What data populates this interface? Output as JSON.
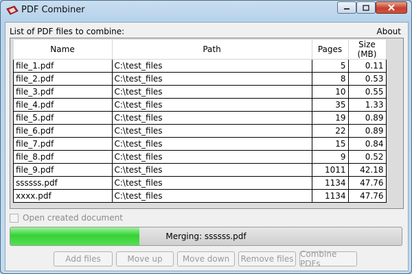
{
  "window": {
    "title": "PDF Combiner",
    "icon": "pdf-icon"
  },
  "header": {
    "list_label": "List of PDF files to combine:",
    "about": "About"
  },
  "table": {
    "columns": [
      "Name",
      "Path",
      "Pages",
      "Size (MB)"
    ],
    "rows": [
      {
        "name": "file_1.pdf",
        "path": "C:\\test_files",
        "pages": "5",
        "size": "0.11"
      },
      {
        "name": "file_2.pdf",
        "path": "C:\\test_files",
        "pages": "8",
        "size": "0.53"
      },
      {
        "name": "file_3.pdf",
        "path": "C:\\test_files",
        "pages": "10",
        "size": "0.55"
      },
      {
        "name": "file_4.pdf",
        "path": "C:\\test_files",
        "pages": "35",
        "size": "1.33"
      },
      {
        "name": "file_5.pdf",
        "path": "C:\\test_files",
        "pages": "19",
        "size": "0.89"
      },
      {
        "name": "file_6.pdf",
        "path": "C:\\test_files",
        "pages": "22",
        "size": "0.89"
      },
      {
        "name": "file_7.pdf",
        "path": "C:\\test_files",
        "pages": "15",
        "size": "0.84"
      },
      {
        "name": "file_8.pdf",
        "path": "C:\\test_files",
        "pages": "9",
        "size": "0.52"
      },
      {
        "name": "file_9.pdf",
        "path": "C:\\test_files",
        "pages": "1011",
        "size": "42.18"
      },
      {
        "name": "ssssss.pdf",
        "path": "C:\\test_files",
        "pages": "1134",
        "size": "47.76"
      },
      {
        "name": "xxxx.pdf",
        "path": "C:\\test_files",
        "pages": "1134",
        "size": "47.76"
      }
    ]
  },
  "options": {
    "open_created_label": "Open created document",
    "open_created_checked": false
  },
  "progress": {
    "text": "Merging: ssssss.pdf",
    "fraction": 0.33
  },
  "buttons": {
    "add_files": "Add files",
    "move_up": "Move up",
    "move_down": "Move down",
    "remove_files": "Remove files",
    "combine": "Combine PDFs"
  },
  "colors": {
    "progress_green": "#35d235",
    "close_red": "#c8412c"
  }
}
